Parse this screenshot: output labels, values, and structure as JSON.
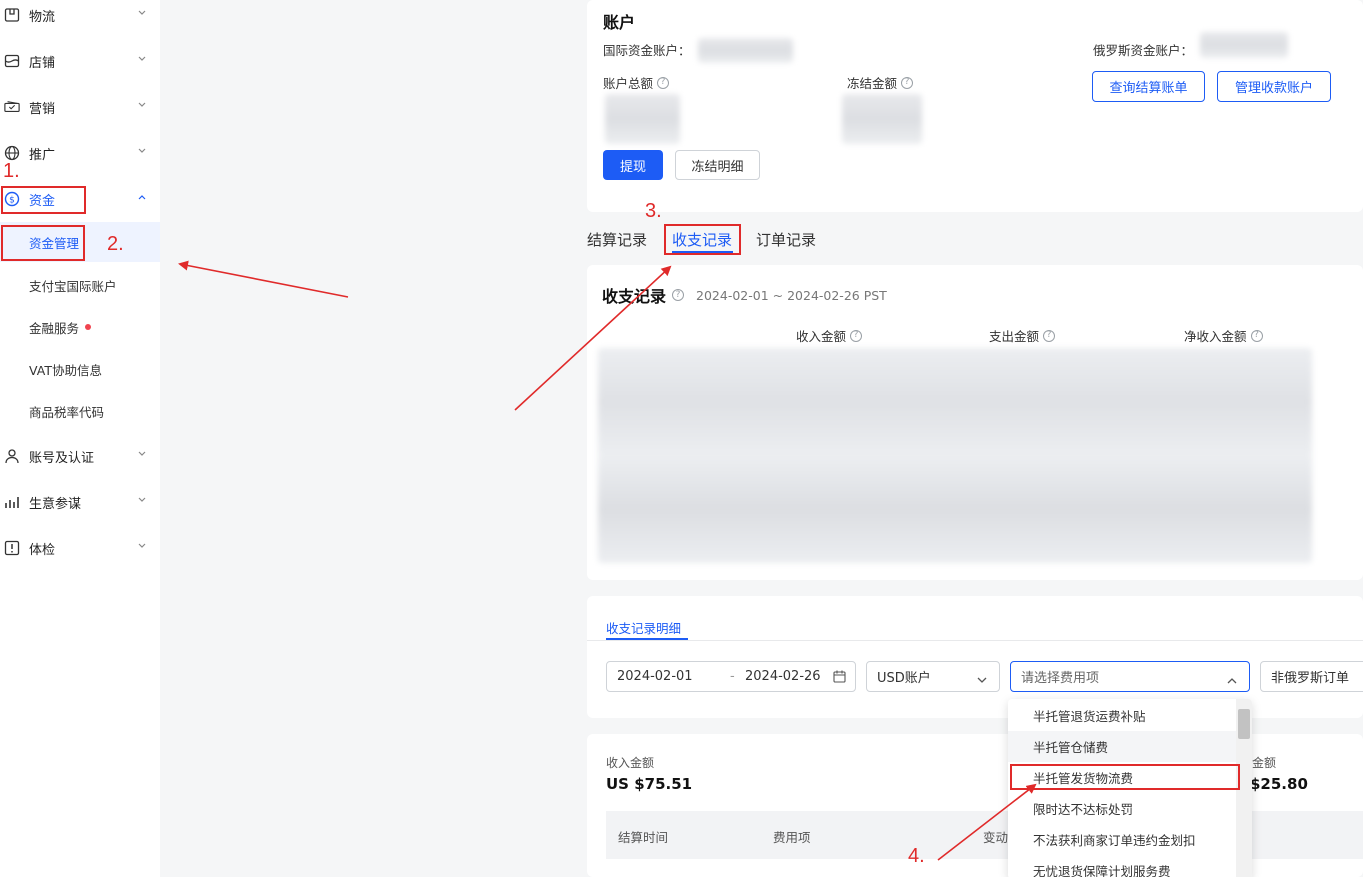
{
  "sidebar": {
    "items": [
      {
        "label": "物流",
        "icon": "logistics-box-icon"
      },
      {
        "label": "店铺",
        "icon": "store-icon"
      },
      {
        "label": "营销",
        "icon": "marketing-ticket-icon"
      },
      {
        "label": "推广",
        "icon": "globe-icon"
      },
      {
        "label": "资金",
        "icon": "dollar-circle-icon"
      },
      {
        "label": "账号及认证",
        "icon": "user-icon"
      },
      {
        "label": "生意参谋",
        "icon": "bar-chart-icon"
      },
      {
        "label": "体检",
        "icon": "health-check-icon"
      }
    ],
    "sub_items": [
      {
        "label": "资金管理"
      },
      {
        "label": "支付宝国际账户"
      },
      {
        "label": "金融服务"
      },
      {
        "label": "VAT协助信息"
      },
      {
        "label": "商品税率代码"
      }
    ]
  },
  "annotations": {
    "n1": "1.",
    "n2": "2.",
    "n3": "3.",
    "n4": "4."
  },
  "account": {
    "title": "账户",
    "intl_account_label": "国际资金账户：",
    "ru_account_label": "俄罗斯资金账户：",
    "total_label": "账户总额",
    "frozen_label": "冻结金额",
    "query_settlement_btn": "查询结算账单",
    "manage_receipt_btn": "管理收款账户",
    "withdraw_btn": "提现",
    "frozen_detail_btn": "冻结明细"
  },
  "tabs": [
    {
      "label": "结算记录"
    },
    {
      "label": "收支记录"
    },
    {
      "label": "订单记录"
    }
  ],
  "records": {
    "title": "收支记录",
    "date_range": "2024-02-01 ~ 2024-02-26 PST",
    "col_income": "收入金额",
    "col_expense": "支出金额",
    "col_net": "净收入金额"
  },
  "detail": {
    "tab_label": "收支记录明细",
    "start_date": "2024-02-01",
    "date_sep": "-",
    "end_date": "2024-02-26",
    "currency_select": "USD账户",
    "fee_placeholder": "请选择费用项",
    "order_select": "非俄罗斯订单"
  },
  "fee_options": [
    "半托管退货运费补贴",
    "半托管仓储费",
    "半托管发货物流费",
    "限时达不达标处罚",
    "不法获利商家订单违约金划扣",
    "无忧退货保障计划服务费"
  ],
  "summary": {
    "income_label": "收入金额",
    "income_value": "US $75.51",
    "partial_label": "金额",
    "partial_value": "$25.80"
  },
  "table": {
    "col_time": "结算时间",
    "col_fee": "费用项",
    "col_change": "变动"
  },
  "colors": {
    "accent": "#1d5cf5",
    "annotation": "#e02a2a"
  }
}
